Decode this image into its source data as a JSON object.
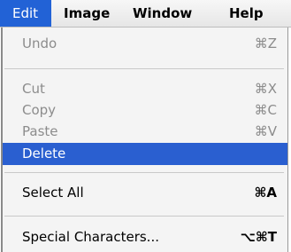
{
  "menubar": {
    "items": [
      {
        "label": "Edit",
        "active": true
      },
      {
        "label": "Image"
      },
      {
        "label": "Window"
      },
      {
        "label": "Help"
      }
    ]
  },
  "menu": {
    "items": [
      {
        "label": "Undo",
        "shortcut": "⌘Z",
        "state": "disabled"
      },
      {
        "label": "Cut",
        "shortcut": "⌘X",
        "state": "disabled"
      },
      {
        "label": "Copy",
        "shortcut": "⌘C",
        "state": "disabled"
      },
      {
        "label": "Paste",
        "shortcut": "⌘V",
        "state": "disabled"
      },
      {
        "label": "Delete",
        "shortcut": "",
        "state": "highlighted"
      },
      {
        "label": "Select All",
        "shortcut": "⌘A",
        "state": "enabled"
      },
      {
        "label": "Special Characters...",
        "shortcut": "⌥⌘T",
        "state": "enabled"
      }
    ]
  },
  "colors": {
    "highlight": "#2a5fd0",
    "menu_background": "#f4f4f4",
    "disabled_text": "#8c8c8c"
  }
}
